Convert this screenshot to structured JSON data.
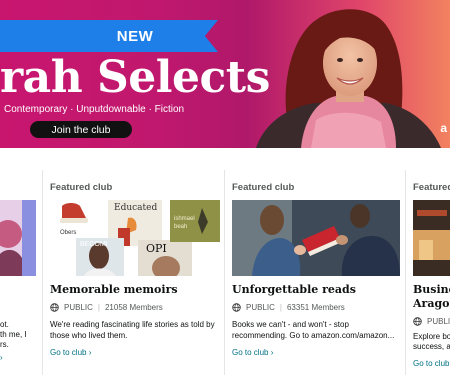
{
  "banner": {
    "ribbon_label": "NEW",
    "title": "rah Selects",
    "tagline": "Contemporary · Unputdownable · Fiction",
    "join_label": "Join the club",
    "logo": "a"
  },
  "left_card": {
    "desc_line1": "ot.",
    "desc_line2": "th me, I",
    "desc_line3": "rs.",
    "link": "›"
  },
  "cards": [
    {
      "label": "Featured club",
      "title": "Memorable memoirs",
      "visibility": "PUBLIC",
      "members": "21058 Members",
      "description": "We're reading fascinating life stories as told by those who lived them.",
      "link": "Go to club ›",
      "book_titles": [
        "Educated",
        "BECOMI",
        "ishmael beah",
        "OPI",
        "Obers"
      ]
    },
    {
      "label": "Featured club",
      "title": "Unforgettable reads",
      "visibility": "PUBLIC",
      "members": "63351 Members",
      "description": "Books we can't - and won't - stop recommending. Go to amazon.com/amazon...",
      "link": "Go to club ›"
    },
    {
      "label": "Featured",
      "title_line1": "Busines",
      "title_line2": "Aragon",
      "visibility": "PUBLIC",
      "desc_line1": "Explore bo",
      "desc_line2": "success, an",
      "link": "Go to club"
    }
  ],
  "colors": {
    "banner_pink": "#c8166f",
    "banner_coral": "#f2825f",
    "ribbon_blue": "#1e7fe8",
    "link": "#007185"
  }
}
